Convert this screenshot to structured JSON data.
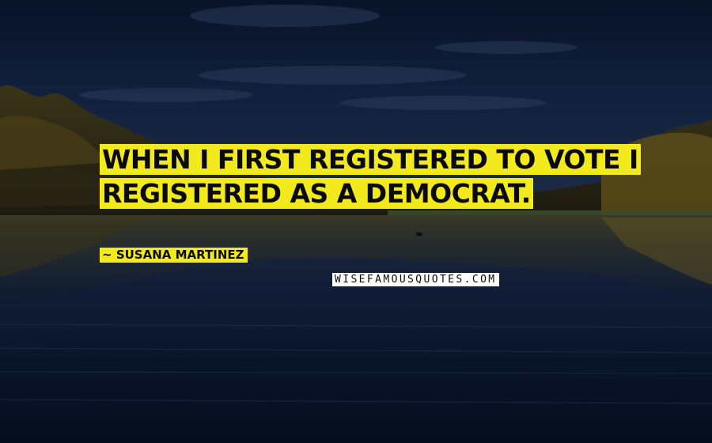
{
  "quote": {
    "text": "When I first registered to vote I registered as a Democrat."
  },
  "author": {
    "name": "Susana Martinez",
    "prefix": "~"
  },
  "watermark": {
    "text": "WISEFAMOUSQUOTES.COM"
  },
  "colors": {
    "highlight": "#f2ea1d",
    "sky": "#0b1630",
    "water": "#0e1a33",
    "trees": "#6a5a1c"
  }
}
